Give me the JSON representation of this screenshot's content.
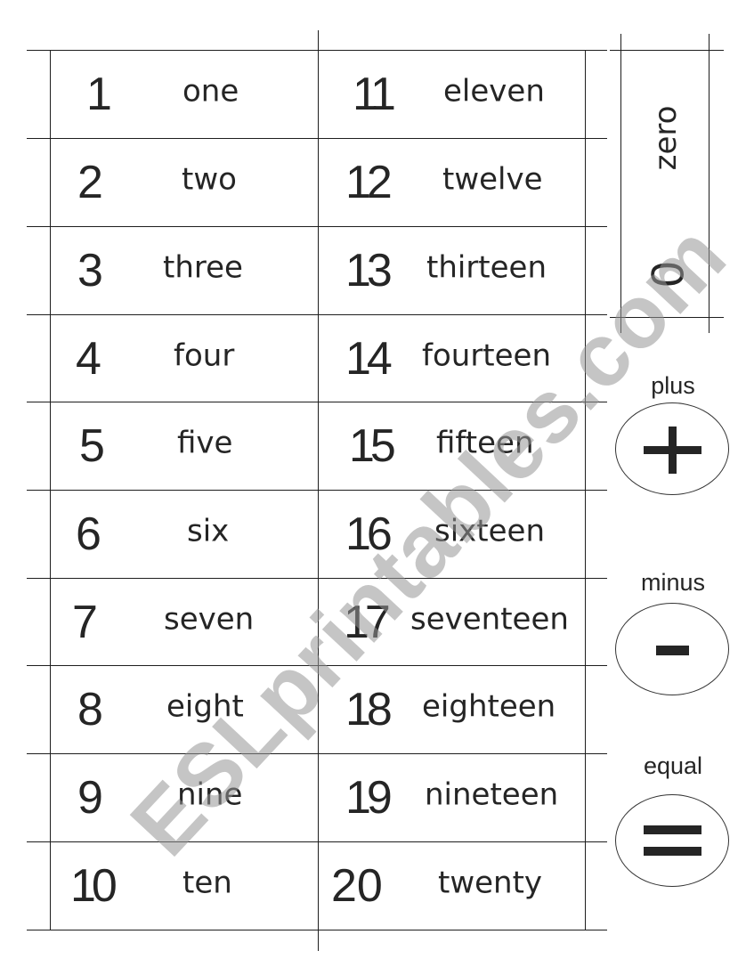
{
  "left_column": [
    {
      "numeral": "1",
      "word": "one"
    },
    {
      "numeral": "2",
      "word": "two"
    },
    {
      "numeral": "3",
      "word": "three"
    },
    {
      "numeral": "4",
      "word": "four"
    },
    {
      "numeral": "5",
      "word": "five"
    },
    {
      "numeral": "6",
      "word": "six"
    },
    {
      "numeral": "7",
      "word": "seven"
    },
    {
      "numeral": "8",
      "word": "eight"
    },
    {
      "numeral": "9",
      "word": "nine"
    },
    {
      "numeral": "10",
      "word": "ten"
    }
  ],
  "right_column": [
    {
      "numeral": "11",
      "word": "eleven"
    },
    {
      "numeral": "12",
      "word": "twelve"
    },
    {
      "numeral": "13",
      "word": "thirteen"
    },
    {
      "numeral": "14",
      "word": "fourteen"
    },
    {
      "numeral": "15",
      "word": "fifteen"
    },
    {
      "numeral": "16",
      "word": "sixteen"
    },
    {
      "numeral": "17",
      "word": "seventeen"
    },
    {
      "numeral": "18",
      "word": "eighteen"
    },
    {
      "numeral": "19",
      "word": "nineteen"
    },
    {
      "numeral": "20",
      "word": "twenty"
    }
  ],
  "zero_card": {
    "numeral": "0",
    "word": "zero"
  },
  "operators": [
    {
      "label": "plus",
      "symbol": "plus-icon"
    },
    {
      "label": "minus",
      "symbol": "minus-icon"
    },
    {
      "label": "equal",
      "symbol": "equals-icon"
    }
  ],
  "watermark": "ESLprintables.com"
}
